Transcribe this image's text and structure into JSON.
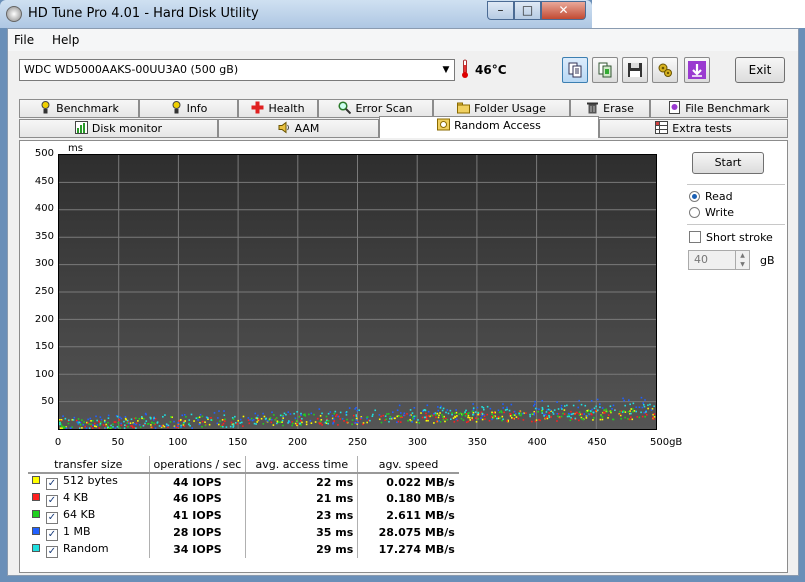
{
  "window": {
    "title": "HD Tune Pro 4.01 - Hard Disk Utility",
    "min": "–",
    "max": "□",
    "close": "✕"
  },
  "menu": {
    "file": "File",
    "help": "Help"
  },
  "toolbar": {
    "drive": "WDC WD5000AAKS-00UU3A0 (500 gB)",
    "temperature": "46°C",
    "exit": "Exit",
    "icons": [
      "copy-info-icon",
      "copy-screenshot-icon",
      "save-icon",
      "options-icon",
      "download-icon"
    ]
  },
  "tabs_top": [
    "Benchmark",
    "Info",
    "Health",
    "Error Scan",
    "Folder Usage",
    "Erase",
    "File Benchmark"
  ],
  "tabs_bottom": [
    "Disk monitor",
    "AAM",
    "Random Access",
    "Extra tests"
  ],
  "side": {
    "start": "Start",
    "read": "Read",
    "write": "Write",
    "short_stroke": "Short stroke",
    "stroke_value": "40",
    "unit": "gB"
  },
  "chart_data": {
    "type": "scatter",
    "ylabel": "ms",
    "ylim": [
      0,
      500
    ],
    "xlim": [
      0,
      500
    ],
    "x_unit": "gB",
    "yticks": [
      "500",
      "450",
      "400",
      "350",
      "300",
      "250",
      "200",
      "150",
      "100",
      "50"
    ],
    "xticks": [
      "0",
      "50",
      "100",
      "150",
      "200",
      "250",
      "300",
      "350",
      "400",
      "450",
      "500gB"
    ],
    "grid": true,
    "series": [
      {
        "name": "512 bytes",
        "color": "#ffff00",
        "avg_ms": 22
      },
      {
        "name": "4 KB",
        "color": "#ff2020",
        "avg_ms": 21
      },
      {
        "name": "64 KB",
        "color": "#20d020",
        "avg_ms": 23
      },
      {
        "name": "1 MB",
        "color": "#2060ff",
        "avg_ms": 35
      },
      {
        "name": "Random",
        "color": "#20e0e0",
        "avg_ms": 29
      }
    ]
  },
  "results": {
    "headers": [
      "transfer size",
      "operations / sec",
      "avg. access time",
      "agv. speed"
    ],
    "rows": [
      {
        "size": "512 bytes",
        "color": "#ffff00",
        "ops": "44 IOPS",
        "access": "22 ms",
        "speed": "0.022 MB/s"
      },
      {
        "size": "4 KB",
        "color": "#ff2020",
        "ops": "46 IOPS",
        "access": "21 ms",
        "speed": "0.180 MB/s"
      },
      {
        "size": "64 KB",
        "color": "#20d020",
        "ops": "41 IOPS",
        "access": "23 ms",
        "speed": "2.611 MB/s"
      },
      {
        "size": "1 MB",
        "color": "#2060ff",
        "ops": "28 IOPS",
        "access": "35 ms",
        "speed": "28.075 MB/s"
      },
      {
        "size": "Random",
        "color": "#20e0e0",
        "ops": "34 IOPS",
        "access": "29 ms",
        "speed": "17.274 MB/s"
      }
    ]
  }
}
